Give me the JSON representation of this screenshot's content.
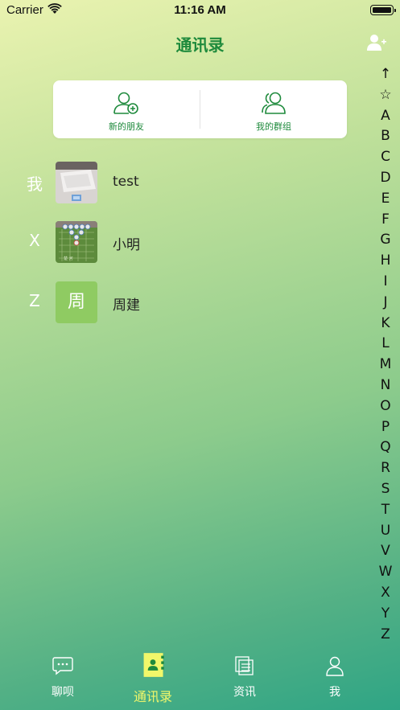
{
  "status_bar": {
    "carrier": "Carrier",
    "time": "11:16 AM"
  },
  "nav": {
    "title": "通讯录",
    "add_icon": "add-contact-icon"
  },
  "quick_actions": [
    {
      "label": "新的朋友",
      "icon": "new-friend-icon"
    },
    {
      "label": "我的群组",
      "icon": "group-icon"
    }
  ],
  "contacts": [
    {
      "section": "我",
      "name": "test",
      "avatar": "photo-laptop"
    },
    {
      "section": "X",
      "name": "小明",
      "avatar": "photo-chessboard"
    },
    {
      "section": "Z",
      "name": "周建",
      "avatar_text": "周"
    }
  ],
  "index": [
    "↑",
    "☆",
    "A",
    "B",
    "C",
    "D",
    "E",
    "F",
    "G",
    "H",
    "I",
    "J",
    "K",
    "L",
    "M",
    "N",
    "O",
    "P",
    "Q",
    "R",
    "S",
    "T",
    "U",
    "V",
    "W",
    "X",
    "Y",
    "Z"
  ],
  "tabs": [
    {
      "label": "聊呗",
      "icon": "chat-icon"
    },
    {
      "label": "通讯录",
      "icon": "contacts-icon",
      "active": true
    },
    {
      "label": "资讯",
      "icon": "news-icon"
    },
    {
      "label": "我",
      "icon": "profile-icon"
    }
  ],
  "colors": {
    "accent": "#1e8a3c",
    "active_tab": "#f1f76a",
    "avatar_bg": "#8fcb62"
  }
}
